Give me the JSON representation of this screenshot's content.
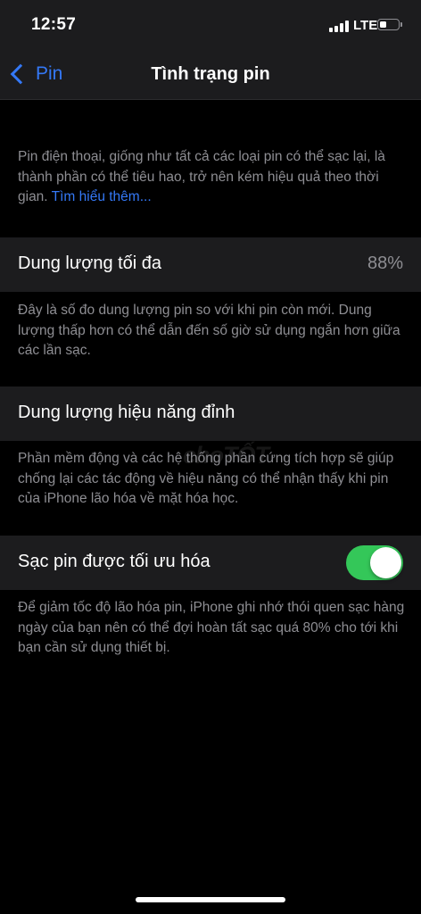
{
  "status_bar": {
    "time": "12:57",
    "network": "LTE",
    "battery_level": 0.35
  },
  "nav": {
    "back_label": "Pin",
    "title": "Tình trạng pin"
  },
  "intro": {
    "text": "Pin điện thoại, giống như tất cả các loại pin có thể sạc lại, là thành phần có thể tiêu hao, trở nên kém hiệu quả theo thời gian. ",
    "link": "Tìm hiểu thêm..."
  },
  "max_capacity": {
    "label": "Dung lượng tối đa",
    "value": "88%",
    "footnote": "Đây là số đo dung lượng pin so với khi pin còn mới. Dung lượng thấp hơn có thể dẫn đến số giờ sử dụng ngắn hơn giữa các lần sạc."
  },
  "peak_performance": {
    "label": "Dung lượng hiệu năng đỉnh",
    "footnote": "Phần mềm động và các hệ thống phần cứng tích hợp sẽ giúp chống lại các tác động về hiệu năng có thể nhận thấy khi pin của iPhone lão hóa về mặt hóa học."
  },
  "optimized_charging": {
    "label": "Sạc pin được tối ưu hóa",
    "enabled": true,
    "footnote": "Để giảm tốc độ lão hóa pin, iPhone ghi nhớ thói quen sạc hàng ngày của bạn nên có thể đợi hoàn tất sạc quá 80% cho tới khi bạn cần sử dụng thiết bị."
  },
  "watermark": "choTỐT",
  "colors": {
    "accent": "#3478f6",
    "toggle_on": "#34c759",
    "cell_background": "#1c1c1e",
    "secondary_text": "#8e8e93"
  }
}
